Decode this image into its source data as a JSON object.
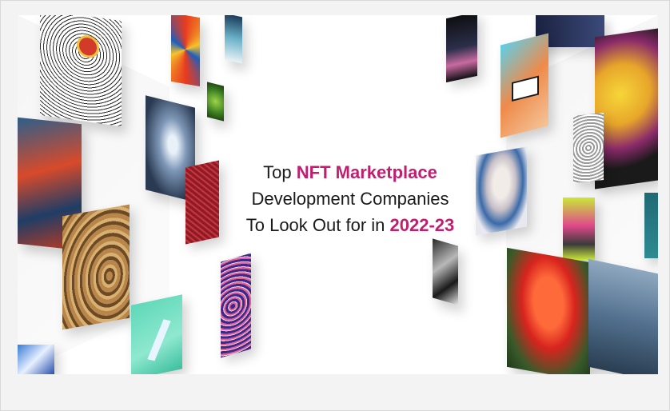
{
  "headline": {
    "line1_prefix": "Top",
    "line1_accent": "NFT Marketplace",
    "line2": "Development Companies",
    "line3_prefix": "To Look Out for in",
    "line3_accent": "2022-23"
  },
  "colors": {
    "accent": "#c21e6f",
    "text": "#1a1a1a",
    "background": "#ffffff",
    "page": "#f3f3f3"
  }
}
